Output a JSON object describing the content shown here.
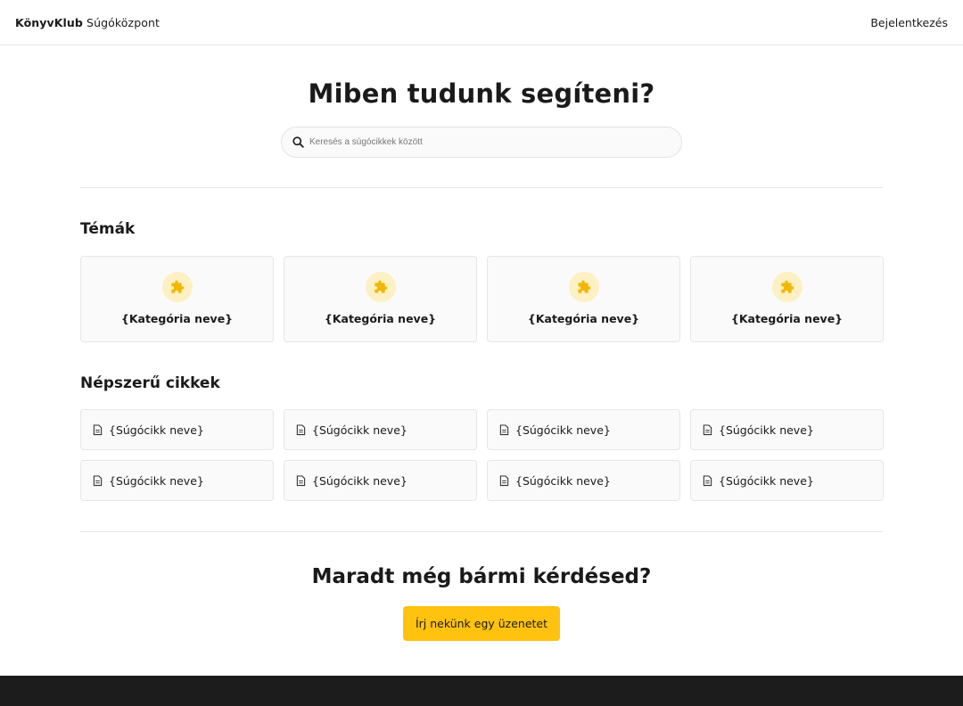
{
  "header": {
    "brand_name": "KönyvKlub",
    "brand_suffix": "Súgóközpont",
    "login_label": "Bejelentkezés"
  },
  "hero": {
    "title": "Miben tudunk segíteni?",
    "search_placeholder": "Keresés a súgócikkek között",
    "search_value": ""
  },
  "topics": {
    "title": "Témák",
    "items": [
      {
        "label": "{Kategória neve}",
        "icon": "puzzle-icon"
      },
      {
        "label": "{Kategória neve}",
        "icon": "puzzle-icon"
      },
      {
        "label": "{Kategória neve}",
        "icon": "puzzle-icon"
      },
      {
        "label": "{Kategória neve}",
        "icon": "puzzle-icon"
      }
    ]
  },
  "popular": {
    "title": "Népszerű cikkek",
    "items": [
      {
        "label": "{Súgócikk neve}",
        "icon": "document-icon"
      },
      {
        "label": "{Súgócikk neve}",
        "icon": "document-icon"
      },
      {
        "label": "{Súgócikk neve}",
        "icon": "document-icon"
      },
      {
        "label": "{Súgócikk neve}",
        "icon": "document-icon"
      },
      {
        "label": "{Súgócikk neve}",
        "icon": "document-icon"
      },
      {
        "label": "{Súgócikk neve}",
        "icon": "document-icon"
      },
      {
        "label": "{Súgócikk neve}",
        "icon": "document-icon"
      },
      {
        "label": "{Súgócikk neve}",
        "icon": "document-icon"
      }
    ]
  },
  "cta": {
    "title": "Maradt még bármi kérdésed?",
    "button_label": "Írj nekünk egy üzenetet"
  },
  "colors": {
    "accent": "#ffc20e",
    "icon_bg": "#fdf0c2",
    "footer": "#1c1c1c"
  }
}
